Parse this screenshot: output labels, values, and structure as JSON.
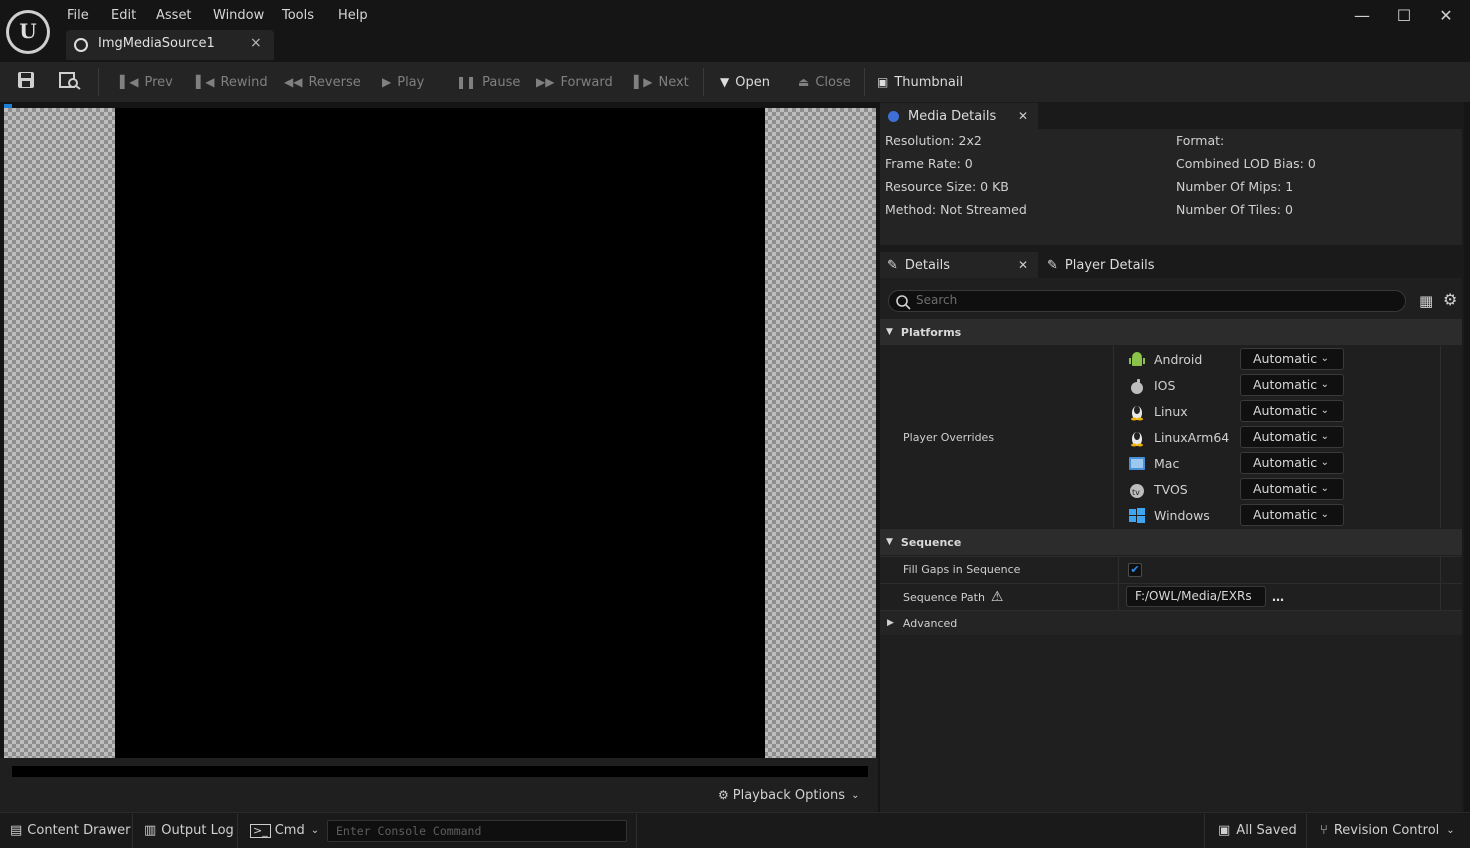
{
  "menu": [
    "File",
    "Edit",
    "Asset",
    "Window",
    "Tools",
    "Help"
  ],
  "document_tab": {
    "label": "ImgMediaSource1",
    "close": "×"
  },
  "window_controls": {
    "minimize": "—",
    "maximize": "☐",
    "close": "✕"
  },
  "toolbar": {
    "prev": "Prev",
    "rewind": "Rewind",
    "reverse": "Reverse",
    "play": "Play",
    "pause": "Pause",
    "forward": "Forward",
    "next": "Next",
    "open": "Open",
    "close": "Close",
    "thumbnail": "Thumbnail"
  },
  "viewport": {
    "playback_options": "Playback Options"
  },
  "media_details": {
    "tab": "Media Details",
    "left": [
      "Resolution: 2x2",
      "Frame Rate: 0",
      "Resource Size: 0 KB",
      "Method: Not Streamed"
    ],
    "right": [
      "Format:",
      "Combined LOD Bias: 0",
      "Number Of Mips: 1",
      "Number Of Tiles: 0"
    ]
  },
  "details": {
    "tab": "Details",
    "player_details_tab": "Player Details",
    "search_placeholder": "Search",
    "platforms_category": "Platforms",
    "player_overrides_label": "Player Overrides",
    "platforms": [
      {
        "name": "Android",
        "value": "Automatic",
        "icon": "android-icon"
      },
      {
        "name": "IOS",
        "value": "Automatic",
        "icon": "apple-icon"
      },
      {
        "name": "Linux",
        "value": "Automatic",
        "icon": "linux-icon"
      },
      {
        "name": "LinuxArm64",
        "value": "Automatic",
        "icon": "linux-icon"
      },
      {
        "name": "Mac",
        "value": "Automatic",
        "icon": "mac-icon"
      },
      {
        "name": "TVOS",
        "value": "Automatic",
        "icon": "tvos-icon"
      },
      {
        "name": "Windows",
        "value": "Automatic",
        "icon": "windows-icon"
      }
    ],
    "sequence_category": "Sequence",
    "fill_gaps_label": "Fill Gaps in Sequence",
    "fill_gaps_checked": true,
    "sequence_path_label": "Sequence Path",
    "sequence_path_value": "F:/OWL/Media/EXRs",
    "advanced_category": "Advanced"
  },
  "statusbar": {
    "content_drawer": "Content Drawer",
    "output_log": "Output Log",
    "cmd": "Cmd",
    "console_placeholder": "Enter Console Command",
    "all_saved": "All Saved",
    "revision_control": "Revision Control"
  },
  "colors": {
    "accent_blue": "#1e7fd8",
    "checkbox_blue": "#2e8ef0"
  }
}
